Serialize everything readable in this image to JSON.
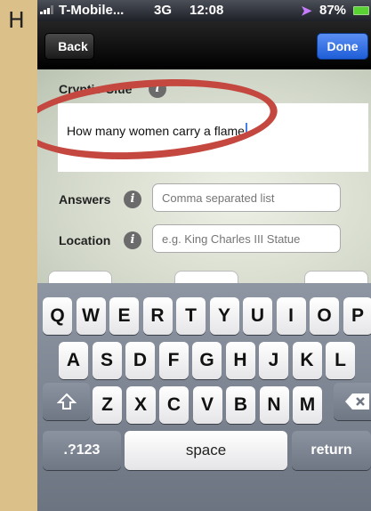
{
  "side_letter": "H",
  "status": {
    "carrier": "T-Mobile...",
    "network": "3G",
    "time": "12:08",
    "battery": "87%"
  },
  "nav": {
    "back_label": "Back",
    "done_label": "Done"
  },
  "form": {
    "clue_label": "Cryptic Clue",
    "clue_value": "How many women carry a flame",
    "answers_label": "Answers",
    "answers_placeholder": "Comma separated list",
    "location_label": "Location",
    "location_placeholder": "e.g. King Charles III Statue"
  },
  "keyboard": {
    "row1": [
      "Q",
      "W",
      "E",
      "R",
      "T",
      "Y",
      "U",
      "I",
      "O",
      "P"
    ],
    "row2": [
      "A",
      "S",
      "D",
      "F",
      "G",
      "H",
      "J",
      "K",
      "L"
    ],
    "row3": [
      "Z",
      "X",
      "C",
      "V",
      "B",
      "N",
      "M"
    ],
    "numbers_label": ".?123",
    "space_label": "space",
    "return_label": "return"
  },
  "colors": {
    "annotation_ellipse": "#c4483f",
    "done_blue": "#2f6ee0"
  }
}
